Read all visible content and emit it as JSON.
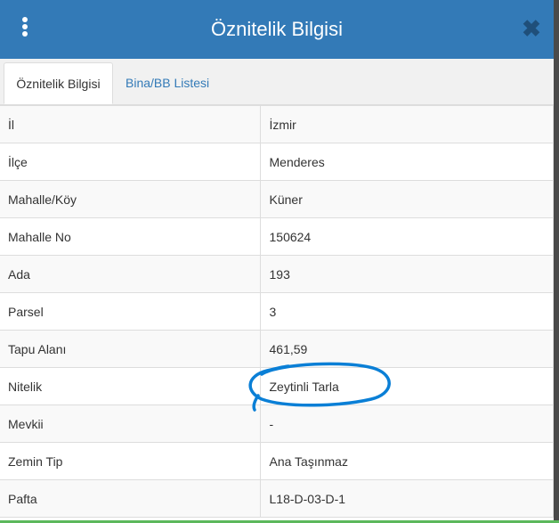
{
  "header": {
    "title": "Öznitelik Bilgisi",
    "menu_icon": "kebab-menu-icon",
    "close_icon": "close-icon",
    "close_glyph": "✖",
    "color": "#337ab7"
  },
  "tabs": [
    {
      "label": "Öznitelik Bilgisi",
      "active": true
    },
    {
      "label": "Bina/BB Listesi",
      "active": false
    }
  ],
  "attributes": [
    {
      "key": "İl",
      "value": "İzmir"
    },
    {
      "key": "İlçe",
      "value": "Menderes"
    },
    {
      "key": "Mahalle/Köy",
      "value": "Küner"
    },
    {
      "key": "Mahalle No",
      "value": "150624"
    },
    {
      "key": "Ada",
      "value": "193"
    },
    {
      "key": "Parsel",
      "value": "3"
    },
    {
      "key": "Tapu Alanı",
      "value": "461,59"
    },
    {
      "key": "Nitelik",
      "value": "Zeytinli Tarla"
    },
    {
      "key": "Mevkii",
      "value": "-"
    },
    {
      "key": "Zemin Tip",
      "value": "Ana Taşınmaz"
    },
    {
      "key": "Pafta",
      "value": "L18-D-03-D-1"
    }
  ],
  "annotation": {
    "shape": "hand-drawn circle",
    "color": "#0a7fd6",
    "target": "Nitelik"
  }
}
